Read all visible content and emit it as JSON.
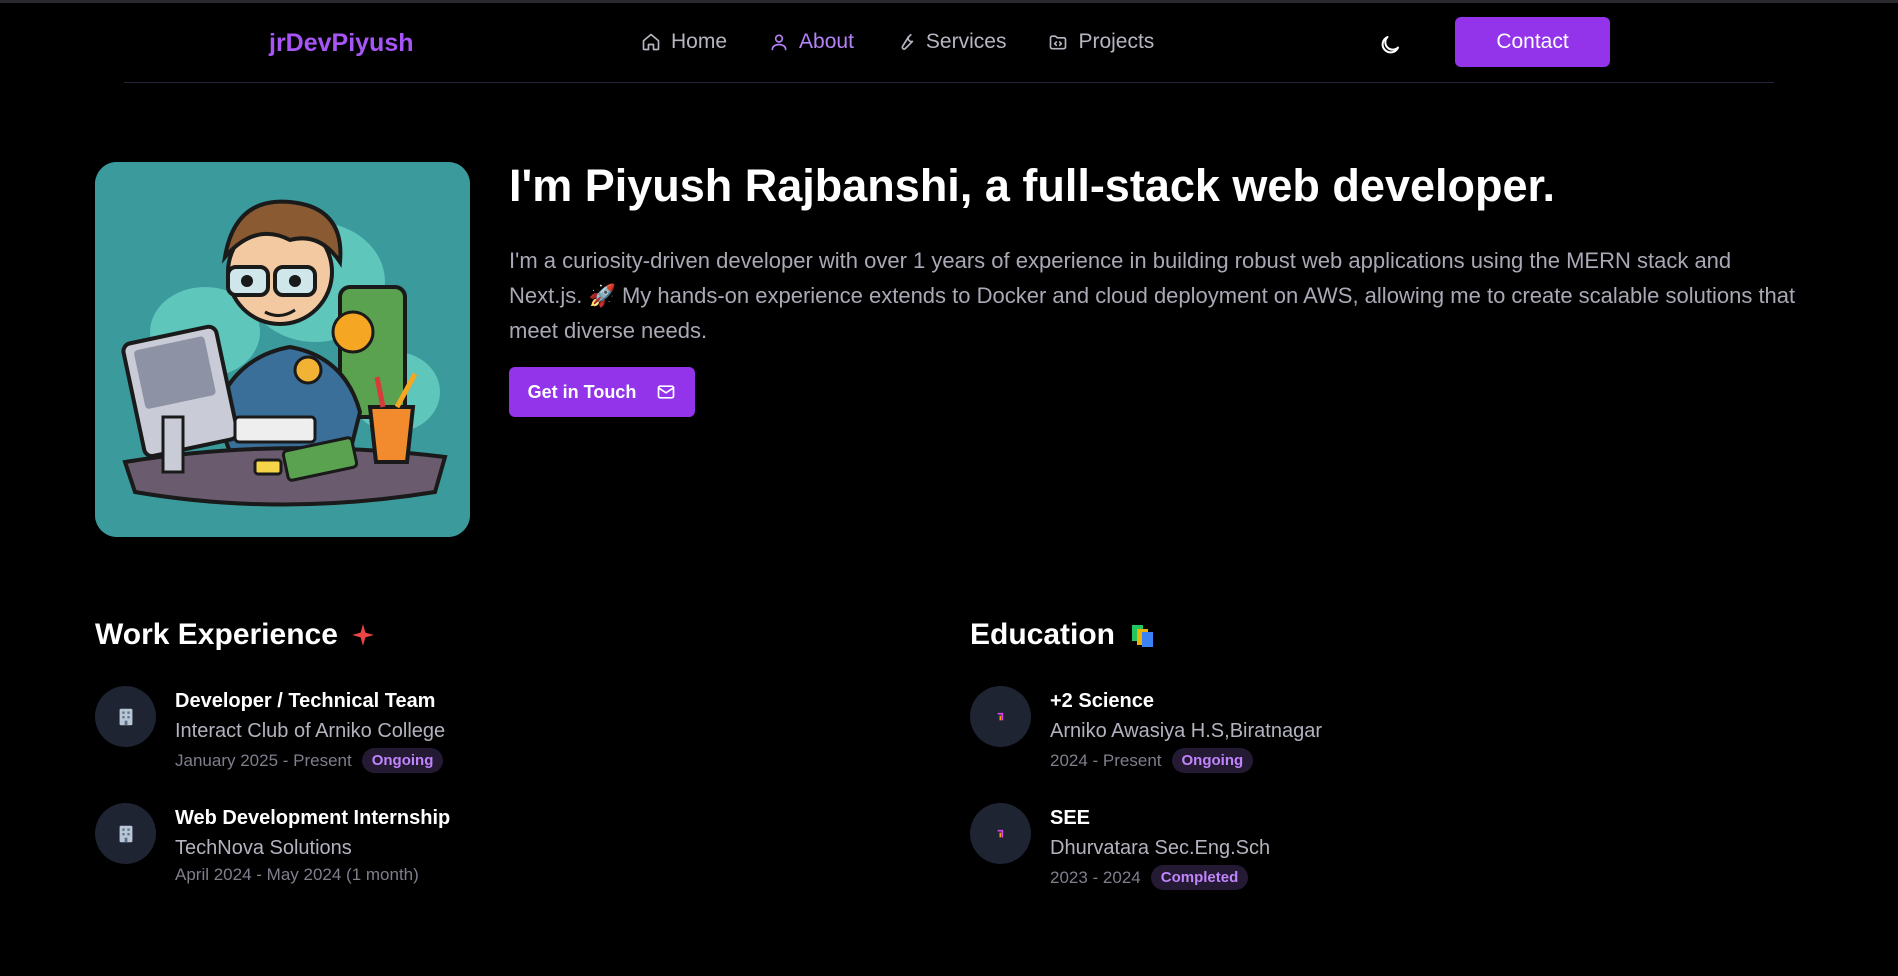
{
  "nav": {
    "brand": "jrDevPiyush",
    "links": [
      {
        "label": "Home",
        "icon": "home-icon"
      },
      {
        "label": "About",
        "icon": "user-icon",
        "active": true
      },
      {
        "label": "Services",
        "icon": "wrench-icon"
      },
      {
        "label": "Projects",
        "icon": "folder-code-icon"
      }
    ],
    "theme_toggle_icon": "moon-icon",
    "contact_label": "Contact"
  },
  "hero": {
    "avatar_icon": "developer-illustration",
    "title": "I'm Piyush Rajbanshi, a full-stack web developer.",
    "description": "I'm a curiosity-driven developer with over 1 years of experience in building robust web applications using the MERN stack and Next.js. 🚀 My hands-on experience extends to Docker and cloud deployment on AWS, allowing me to create scalable solutions that meet diverse needs.",
    "cta_label": "Get in Touch",
    "cta_icon": "mail-icon"
  },
  "work": {
    "title": "Work Experience",
    "title_icon": "sparkle-icon",
    "items": [
      {
        "title": "Developer / Technical Team",
        "org": "Interact Club of Arniko College",
        "date": "January 2025 - Present",
        "badge": "Ongoing",
        "icon": "building-icon"
      },
      {
        "title": "Web Development Internship",
        "org": "TechNova Solutions",
        "date": "April 2024 - May 2024  (1 month)",
        "badge": "",
        "icon": "building-icon"
      }
    ]
  },
  "education": {
    "title": "Education",
    "title_icon": "books-icon",
    "items": [
      {
        "title": "+2 Science",
        "org": "Arniko Awasiya H.S,Biratnagar",
        "date": "2024 - Present",
        "badge": "Ongoing",
        "icon": "pencil-icon"
      },
      {
        "title": "SEE",
        "org": "Dhurvatara Sec.Eng.Sch",
        "date": "2023 - 2024",
        "badge": "Completed",
        "icon": "pencil-icon"
      }
    ]
  },
  "colors": {
    "accent": "#9333ea",
    "accent_text": "#a855f7",
    "background": "#000000"
  }
}
